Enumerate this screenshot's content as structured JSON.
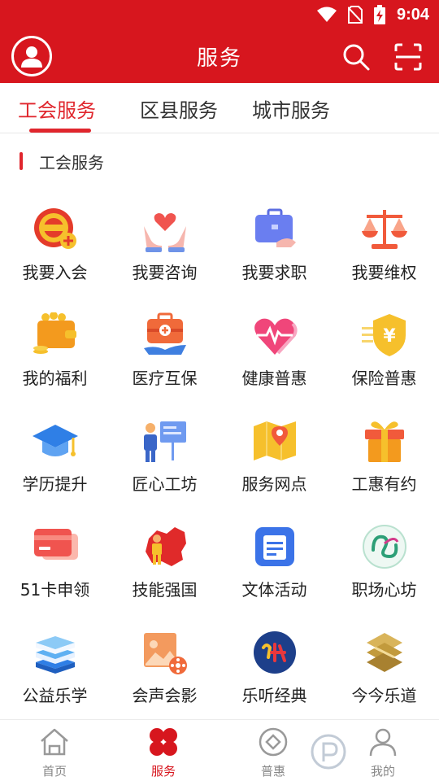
{
  "status_bar": {
    "time": "9:04"
  },
  "header": {
    "title": "服务"
  },
  "tabs": [
    {
      "label": "工会服务",
      "active": true
    },
    {
      "label": "区县服务",
      "active": false
    },
    {
      "label": "城市服务",
      "active": false
    }
  ],
  "section": {
    "title": "工会服务"
  },
  "services": [
    {
      "label": "我要入会",
      "icon": "union-emblem-icon"
    },
    {
      "label": "我要咨询",
      "icon": "heart-hands-icon"
    },
    {
      "label": "我要求职",
      "icon": "briefcase-icon"
    },
    {
      "label": "我要维权",
      "icon": "scales-icon"
    },
    {
      "label": "我的福利",
      "icon": "wallet-coins-icon"
    },
    {
      "label": "医疗互保",
      "icon": "medical-kit-icon"
    },
    {
      "label": "健康普惠",
      "icon": "heartbeat-icon"
    },
    {
      "label": "保险普惠",
      "icon": "shield-yen-icon"
    },
    {
      "label": "学历提升",
      "icon": "graduation-cap-icon"
    },
    {
      "label": "匠心工坊",
      "icon": "presenter-board-icon"
    },
    {
      "label": "服务网点",
      "icon": "map-pin-icon"
    },
    {
      "label": "工惠有约",
      "icon": "gift-box-icon"
    },
    {
      "label": "51卡申领",
      "icon": "card-icon"
    },
    {
      "label": "技能强国",
      "icon": "china-map-worker-icon"
    },
    {
      "label": "文体活动",
      "icon": "calendar-list-icon"
    },
    {
      "label": "职场心坊",
      "icon": "mind-logo-icon"
    },
    {
      "label": "公益乐学",
      "icon": "books-stack-icon"
    },
    {
      "label": "会声会影",
      "icon": "photo-film-icon"
    },
    {
      "label": "乐听经典",
      "icon": "listen-badge-icon"
    },
    {
      "label": "今今乐道",
      "icon": "gold-logo-icon"
    }
  ],
  "bottom_nav": [
    {
      "label": "首页",
      "icon": "home-icon",
      "active": false
    },
    {
      "label": "服务",
      "icon": "clover-icon",
      "active": true
    },
    {
      "label": "普惠",
      "icon": "diamond-circle-icon",
      "active": false
    },
    {
      "label": "我的",
      "icon": "user-icon",
      "active": false
    }
  ],
  "colors": {
    "brand_red": "#d7161e",
    "active_text": "#e0262d",
    "inactive_text": "#888888"
  }
}
